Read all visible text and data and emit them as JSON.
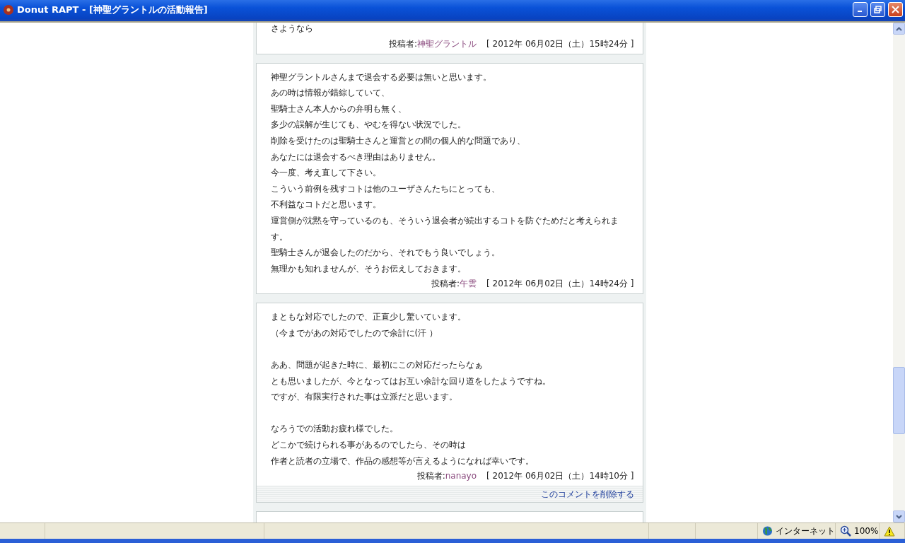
{
  "window": {
    "title": "Donut RAPT - [神聖グラントルの活動報告]"
  },
  "comments": [
    {
      "paragraphs": [
        [
          "さようなら"
        ]
      ],
      "author_label": "投稿者:",
      "author": "神聖グラントル",
      "timestamp": "[ 2012年 06月02日（土）15時24分 ]"
    },
    {
      "paragraphs": [
        [
          "神聖グラントルさんまで退会する必要は無いと思います。",
          "あの時は情報が錯綜していて、",
          "聖騎士さん本人からの弁明も無く、",
          "多少の誤解が生じても、やむを得ない状況でした。",
          "削除を受けたのは聖騎士さんと運営との間の個人的な問題であり、",
          "あなたには退会するべき理由はありません。",
          "今一度、考え直して下さい。",
          "こういう前例を残すコトは他のユーザさんたちにとっても、",
          "不利益なコトだと思います。",
          "運営側が沈黙を守っているのも、そういう退会者が続出するコトを防ぐためだと考えられます。",
          "聖騎士さんが退会したのだから、それでもう良いでしょう。",
          "無理かも知れませんが、そうお伝えしておきます。"
        ]
      ],
      "author_label": "投稿者:",
      "author": "午雲",
      "timestamp": "[ 2012年 06月02日（土）14時24分 ]"
    },
    {
      "paragraphs": [
        [
          "まともな対応でしたので、正直少し驚いています。",
          "（今までがあの対応でしたので余計に(汗 ）"
        ],
        [
          "ああ、問題が起きた時に、最初にこの対応だったらなぁ",
          "とも思いましたが、今となってはお互い余計な回り道をしたようですね。",
          "ですが、有限実行された事は立派だと思います。"
        ],
        [
          "なろうでの活動お疲れ様でした。",
          "どこかで続けられる事があるのでしたら、その時は",
          "作者と読者の立場で、作品の感想等が言えるようになれば幸いです。"
        ]
      ],
      "author_label": "投稿者:",
      "author": "nanayo",
      "timestamp": "[ 2012年 06月02日（土）14時10分 ]",
      "delete_link": "このコメントを削除する"
    }
  ],
  "status_bar": {
    "zone": "インターネット",
    "zoom": "100%"
  }
}
